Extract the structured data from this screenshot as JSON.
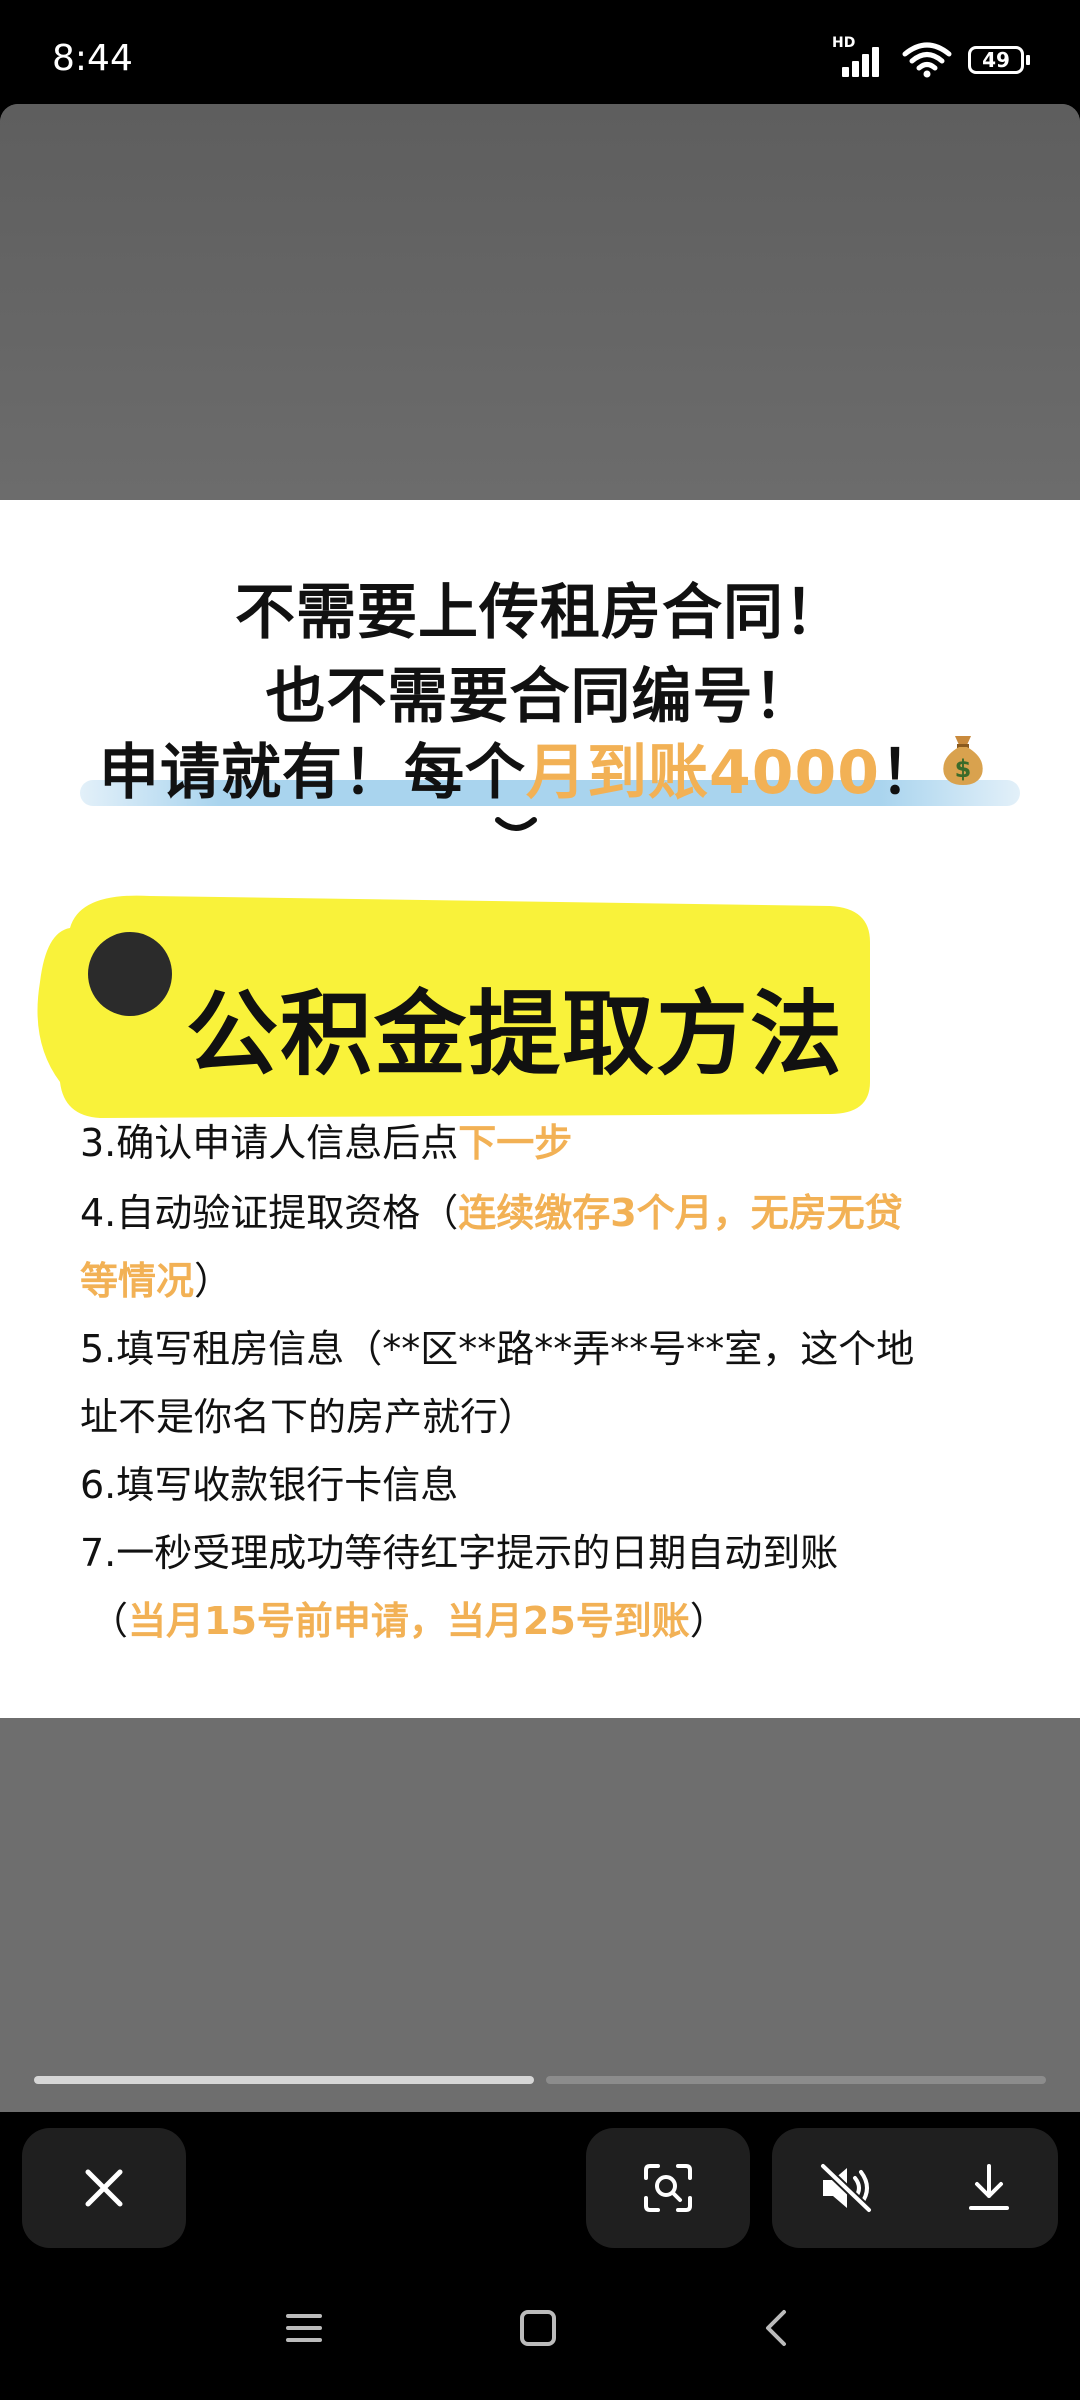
{
  "status_bar": {
    "time": "8:44",
    "network_badge": "HD",
    "battery": "49"
  },
  "image": {
    "headline_1": "不需要上传租房合同！",
    "headline_2": "也不需要合同编号！",
    "headline_3_part1": "申请就有！每个",
    "headline_3_highlight": "月到账4000",
    "headline_3_part2": "！",
    "banner_title": "公积金提取方法",
    "step3_text": "3.确认申请人信息后点",
    "step3_highlight": "下一步",
    "step4_text": "4.自动验证提取资格（",
    "step4_highlight_a": "连续缴存3个月，无房无贷",
    "step4_highlight_b": "等情况",
    "step4_close": "）",
    "step5_line1": "5.填写租房信息（**区**路**弄**号**室，这个地",
    "step5_line2": "址不是你名下的房产就行）",
    "step6": "6.填写收款银行卡信息",
    "step7_line1": "7.一秒受理成功等待红字提示的日期自动到账",
    "step7_open": "（",
    "step7_highlight": "当月15号前申请，当月25号到账",
    "step7_close": "）"
  },
  "progress": {
    "current_index": 1,
    "total": 2
  },
  "toolbar": {
    "close_icon": "close-icon",
    "lens_icon": "image-search-icon",
    "mute_icon": "volume-muted-icon",
    "download_icon": "download-icon"
  },
  "colors": {
    "highlight": "#f2b155",
    "banner_yellow": "#f9f23a",
    "underline_blue": "#a9d4ee"
  }
}
